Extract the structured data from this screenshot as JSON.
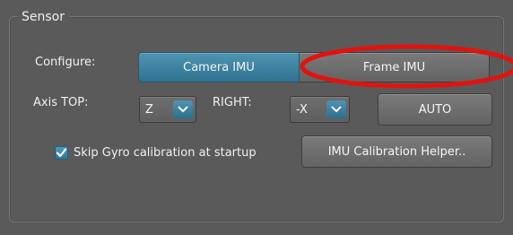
{
  "sensor": {
    "title": "Sensor",
    "configure_label": "Configure:",
    "camera_imu_label": "Camera IMU",
    "frame_imu_label": "Frame IMU",
    "axis_top_label": "Axis TOP:",
    "axis_top_value": "Z",
    "right_label": "RIGHT:",
    "right_value": "-X",
    "auto_label": "AUTO",
    "skip_gyro_label": "Skip Gyro calibration at startup",
    "skip_gyro_checked": true,
    "imu_helper_label": "IMU Calibration Helper.."
  },
  "colors": {
    "background": "#5a5a5a",
    "accent": "#3e88a8",
    "annotation": "#e0130f"
  },
  "icons": {
    "dropdown": "chevron-down-icon",
    "check": "checkmark-icon"
  }
}
